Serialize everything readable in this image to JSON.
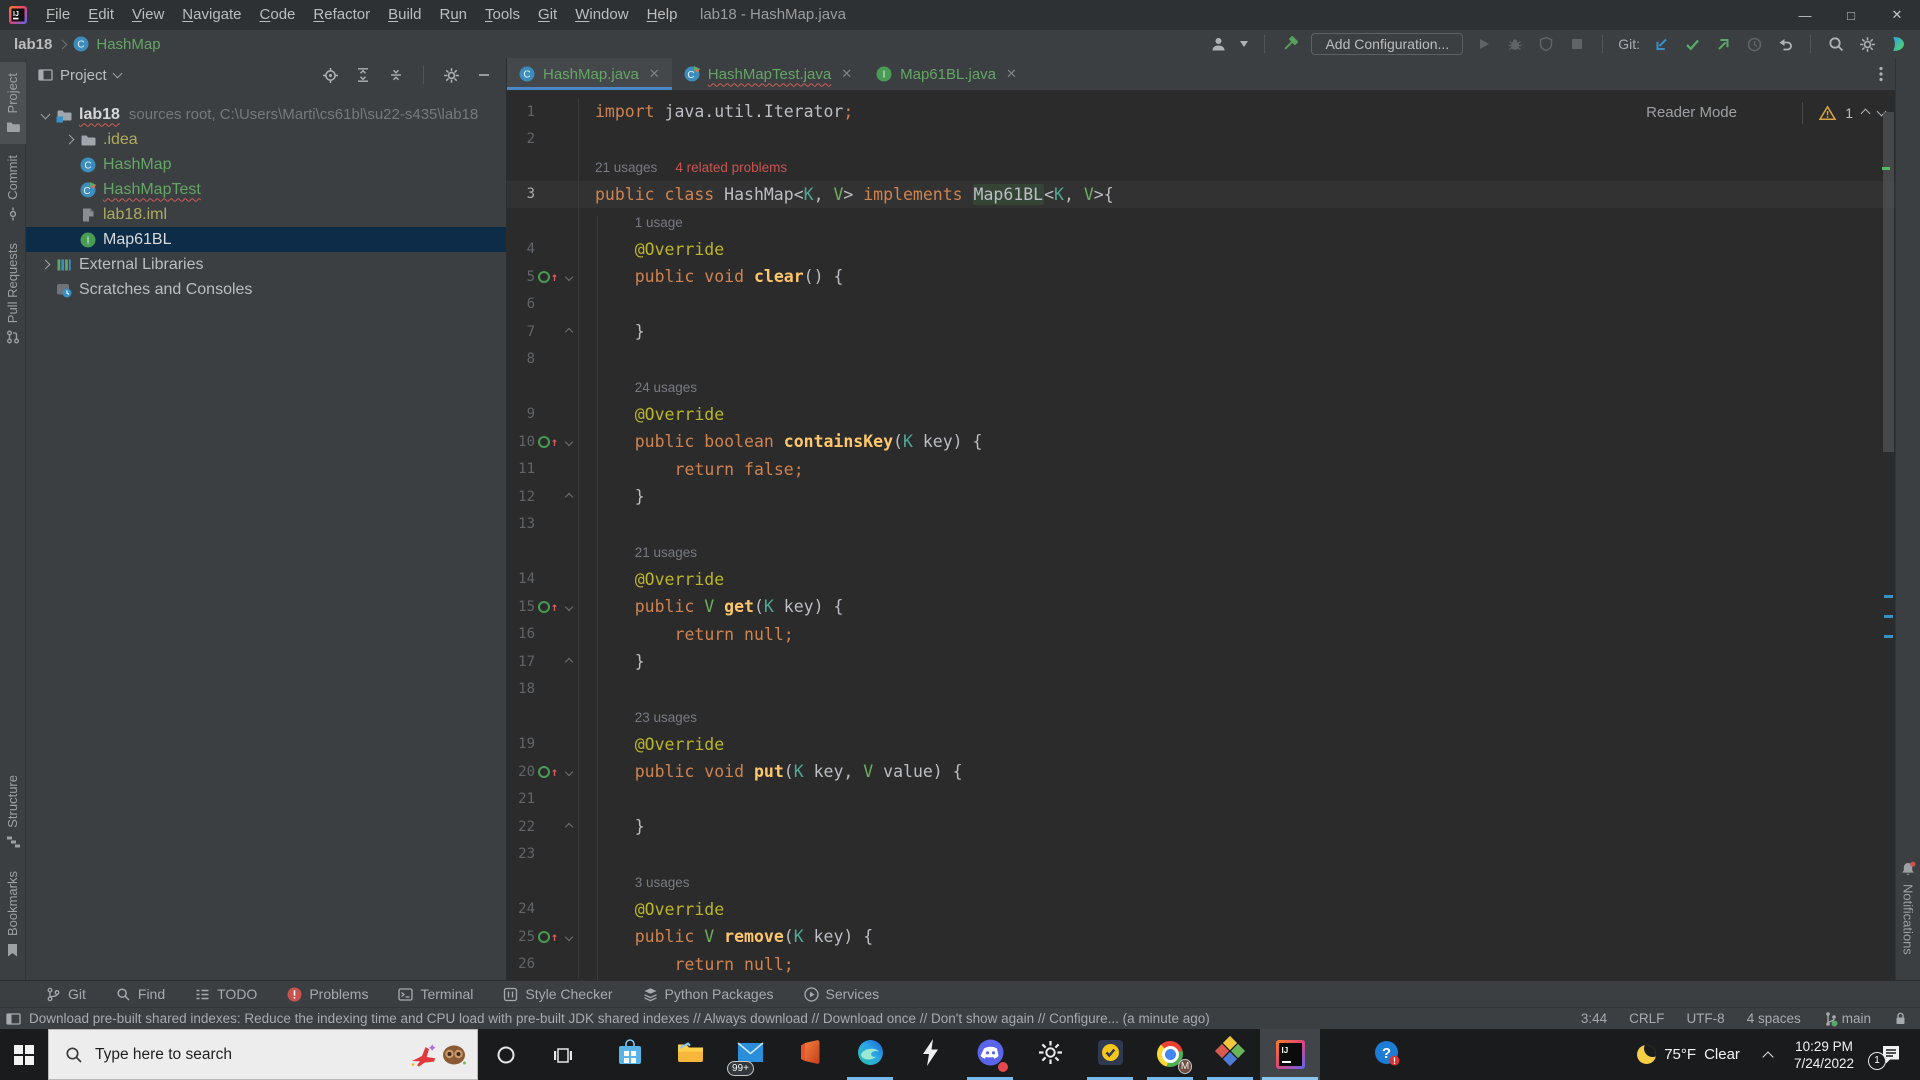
{
  "window": {
    "title": "lab18 - HashMap.java",
    "controls": {
      "minimize": "—",
      "maximize": "□",
      "close": "✕"
    }
  },
  "menu": {
    "items": [
      {
        "label": "File",
        "u": 0
      },
      {
        "label": "Edit",
        "u": 0
      },
      {
        "label": "View",
        "u": 0
      },
      {
        "label": "Navigate",
        "u": 0
      },
      {
        "label": "Code",
        "u": 0
      },
      {
        "label": "Refactor",
        "u": 0
      },
      {
        "label": "Build",
        "u": 0
      },
      {
        "label": "Run",
        "u": 1
      },
      {
        "label": "Tools",
        "u": 0
      },
      {
        "label": "Git",
        "u": 0
      },
      {
        "label": "Window",
        "u": 0
      },
      {
        "label": "Help",
        "u": 0
      }
    ]
  },
  "toolbar": {
    "project": "lab18",
    "breadcrumb_class": "HashMap",
    "add_configuration": "Add Configuration...",
    "git_label": "Git:"
  },
  "left_stripe": {
    "top": [
      {
        "label": "Project",
        "icon": "stripe-project",
        "active": true
      },
      {
        "label": "Commit",
        "icon": "stripe-commit"
      },
      {
        "label": "Pull Requests",
        "icon": "stripe-pr"
      }
    ],
    "bottom": [
      {
        "label": "Structure",
        "icon": "stripe-structure"
      },
      {
        "label": "Bookmarks",
        "icon": "stripe-bookmarks"
      }
    ]
  },
  "right_stripe": {
    "items": [
      {
        "label": "Notifications",
        "icon": "bell"
      }
    ]
  },
  "project_panel": {
    "title": "Project",
    "tree": [
      {
        "ind": 0,
        "exp": "open",
        "icon": "folder-sources",
        "label": "lab18",
        "bold": 1,
        "sqg": 1,
        "suffix": "sources root,  C:\\Users\\Marti\\cs61bl\\su22-s435\\lab18"
      },
      {
        "ind": 1,
        "exp": "closed",
        "icon": "folder",
        "label": ".idea",
        "cls": "olive"
      },
      {
        "ind": 1,
        "icon": "class",
        "label": "HashMap",
        "cls": "green"
      },
      {
        "ind": 1,
        "icon": "class-test",
        "label": "HashMapTest",
        "cls": "green",
        "sqg": 1
      },
      {
        "ind": 1,
        "icon": "file-iml",
        "label": "lab18.iml",
        "cls": "olive"
      },
      {
        "ind": 1,
        "icon": "interface",
        "label": "Map61BL",
        "cls": "sel",
        "selected": 1
      },
      {
        "ind": 0,
        "exp": "closed",
        "icon": "libraries",
        "label": "External Libraries"
      },
      {
        "ind": 0,
        "icon": "scratches",
        "label": "Scratches and Consoles"
      }
    ]
  },
  "editor": {
    "tabs": [
      {
        "icon": "class",
        "label": "HashMap.java",
        "active": 1
      },
      {
        "icon": "class-test",
        "label": "HashMapTest.java",
        "sqg": 1
      },
      {
        "icon": "interface",
        "label": "Map61BL.java"
      }
    ],
    "reader_mode": "Reader Mode",
    "inspections": {
      "warnings": "1"
    },
    "rows": [
      {
        "n": "1",
        "t": [
          [
            "import ",
            "kw"
          ],
          [
            "java.util.Iterator",
            "pl"
          ],
          [
            ";",
            "kw"
          ]
        ]
      },
      {
        "n": "2"
      },
      {
        "inlay": 1,
        "ind": 0,
        "p": [
          [
            "21 usages",
            "us"
          ],
          [
            "4 related problems",
            "pr"
          ]
        ]
      },
      {
        "n": "3",
        "cur": 1,
        "t": [
          [
            "public class ",
            "kw"
          ],
          [
            "HashMap",
            "pl"
          ],
          [
            "<",
            "pl"
          ],
          [
            "K",
            "tk"
          ],
          [
            ", ",
            "pl"
          ],
          [
            "V",
            "tv"
          ],
          [
            "> ",
            "pl"
          ],
          [
            "implements ",
            "kw"
          ],
          [
            "Map61BL",
            "pl",
            "hl"
          ],
          [
            "<",
            "pl"
          ],
          [
            "K",
            "tk"
          ],
          [
            ", ",
            "pl"
          ],
          [
            "V",
            "tv"
          ],
          [
            ">{",
            "pl"
          ]
        ]
      },
      {
        "inlay": 1,
        "ind": 4,
        "p": [
          [
            "1 usage",
            "us"
          ]
        ]
      },
      {
        "n": "4",
        "ind": 4,
        "t": [
          [
            "@Override",
            "an"
          ]
        ]
      },
      {
        "n": "5",
        "ind": 4,
        "ovr": 1,
        "fo": "d",
        "t": [
          [
            "public void ",
            "kw"
          ],
          [
            "clear",
            "me"
          ],
          [
            "() {",
            "pl"
          ]
        ]
      },
      {
        "n": "6"
      },
      {
        "n": "7",
        "ind": 4,
        "fo": "u",
        "t": [
          [
            "}",
            "pl"
          ]
        ]
      },
      {
        "n": "8"
      },
      {
        "inlay": 1,
        "ind": 4,
        "p": [
          [
            "24 usages",
            "us"
          ]
        ]
      },
      {
        "n": "9",
        "ind": 4,
        "t": [
          [
            "@Override",
            "an"
          ]
        ]
      },
      {
        "n": "10",
        "ind": 4,
        "ovr": 1,
        "fo": "d",
        "t": [
          [
            "public boolean ",
            "kw"
          ],
          [
            "containsKey",
            "me"
          ],
          [
            "(",
            "pl"
          ],
          [
            "K",
            "tk"
          ],
          [
            " key) {",
            "pl"
          ]
        ]
      },
      {
        "n": "11",
        "ind": 8,
        "t": [
          [
            "return false;",
            "kw"
          ]
        ]
      },
      {
        "n": "12",
        "ind": 4,
        "fo": "u",
        "t": [
          [
            "}",
            "pl"
          ]
        ]
      },
      {
        "n": "13"
      },
      {
        "inlay": 1,
        "ind": 4,
        "p": [
          [
            "21 usages",
            "us"
          ]
        ]
      },
      {
        "n": "14",
        "ind": 4,
        "t": [
          [
            "@Override",
            "an"
          ]
        ]
      },
      {
        "n": "15",
        "ind": 4,
        "ovr": 1,
        "fo": "d",
        "t": [
          [
            "public ",
            "kw"
          ],
          [
            "V ",
            "tv"
          ],
          [
            "get",
            "me"
          ],
          [
            "(",
            "pl"
          ],
          [
            "K",
            "tk"
          ],
          [
            " key) {",
            "pl"
          ]
        ]
      },
      {
        "n": "16",
        "ind": 8,
        "t": [
          [
            "return null;",
            "kw"
          ]
        ]
      },
      {
        "n": "17",
        "ind": 4,
        "fo": "u",
        "t": [
          [
            "}",
            "pl"
          ]
        ]
      },
      {
        "n": "18"
      },
      {
        "inlay": 1,
        "ind": 4,
        "p": [
          [
            "23 usages",
            "us"
          ]
        ]
      },
      {
        "n": "19",
        "ind": 4,
        "t": [
          [
            "@Override",
            "an"
          ]
        ]
      },
      {
        "n": "20",
        "ind": 4,
        "ovr": 1,
        "fo": "d",
        "t": [
          [
            "public void ",
            "kw"
          ],
          [
            "put",
            "me"
          ],
          [
            "(",
            "pl"
          ],
          [
            "K",
            "tk"
          ],
          [
            " key, ",
            "pl"
          ],
          [
            "V",
            "tv"
          ],
          [
            " value) {",
            "pl"
          ]
        ]
      },
      {
        "n": "21"
      },
      {
        "n": "22",
        "ind": 4,
        "fo": "u",
        "t": [
          [
            "}",
            "pl"
          ]
        ]
      },
      {
        "n": "23"
      },
      {
        "inlay": 1,
        "ind": 4,
        "p": [
          [
            "3 usages",
            "us"
          ]
        ]
      },
      {
        "n": "24",
        "ind": 4,
        "t": [
          [
            "@Override",
            "an"
          ]
        ]
      },
      {
        "n": "25",
        "ind": 4,
        "ovr": 1,
        "fo": "d",
        "t": [
          [
            "public ",
            "kw"
          ],
          [
            "V ",
            "tv"
          ],
          [
            "remove",
            "me"
          ],
          [
            "(",
            "pl"
          ],
          [
            "K",
            "tk"
          ],
          [
            " key) {",
            "pl"
          ]
        ]
      },
      {
        "n": "26",
        "ind": 8,
        "t": [
          [
            "return null;",
            "kw"
          ]
        ]
      }
    ]
  },
  "bottom_bar": {
    "items": [
      {
        "label": "Git",
        "icon": "bb-git"
      },
      {
        "label": "Find",
        "icon": "bb-find"
      },
      {
        "label": "TODO",
        "icon": "bb-todo"
      },
      {
        "label": "Problems",
        "icon": "bb-problems"
      },
      {
        "label": "Terminal",
        "icon": "bb-terminal"
      },
      {
        "label": "Style Checker",
        "icon": "bb-style"
      },
      {
        "label": "Python Packages",
        "icon": "bb-packages"
      },
      {
        "label": "Services",
        "icon": "bb-services"
      }
    ]
  },
  "status_bar": {
    "message": "Download pre-built shared indexes: Reduce the indexing time and CPU load with pre-built JDK shared indexes // Always download // Download once // Don't show again // Configure... (a minute ago)",
    "caret_position": "3:44",
    "line_sep": "CRLF",
    "encoding": "UTF-8",
    "indent": "4 spaces",
    "branch": "main"
  },
  "taskbar": {
    "search_placeholder": "Type here to search",
    "apps": [
      {
        "name": "store"
      },
      {
        "name": "explorer"
      },
      {
        "name": "mail",
        "badge": "99+"
      },
      {
        "name": "office"
      },
      {
        "name": "edge",
        "active": 1
      },
      {
        "name": "lightning"
      },
      {
        "name": "discord",
        "active": 1,
        "dot": 1
      },
      {
        "name": "settings"
      },
      {
        "name": "norton",
        "active": 1
      },
      {
        "name": "chrome",
        "active": 1,
        "badge": "M"
      },
      {
        "name": "diamond",
        "active": 1
      },
      {
        "name": "intellij",
        "active": 1,
        "focused": 1
      },
      {
        "name": "gethelp",
        "gap": 1
      }
    ],
    "tray": {
      "temp": "75°F",
      "condition": "Clear",
      "time": "10:29 PM",
      "date": "7/24/2022",
      "notification_count": "1"
    }
  },
  "colors": {
    "accent_blue": "#4A88C7",
    "added_green": "#65A565",
    "keyword_orange": "#CF8350",
    "selection_bg": "#0D2C47",
    "warning_yellow": "#D8A343",
    "error_red": "#CF5B56",
    "editor_bg": "#2B2B2B",
    "panel_bg": "#3C3F41"
  }
}
